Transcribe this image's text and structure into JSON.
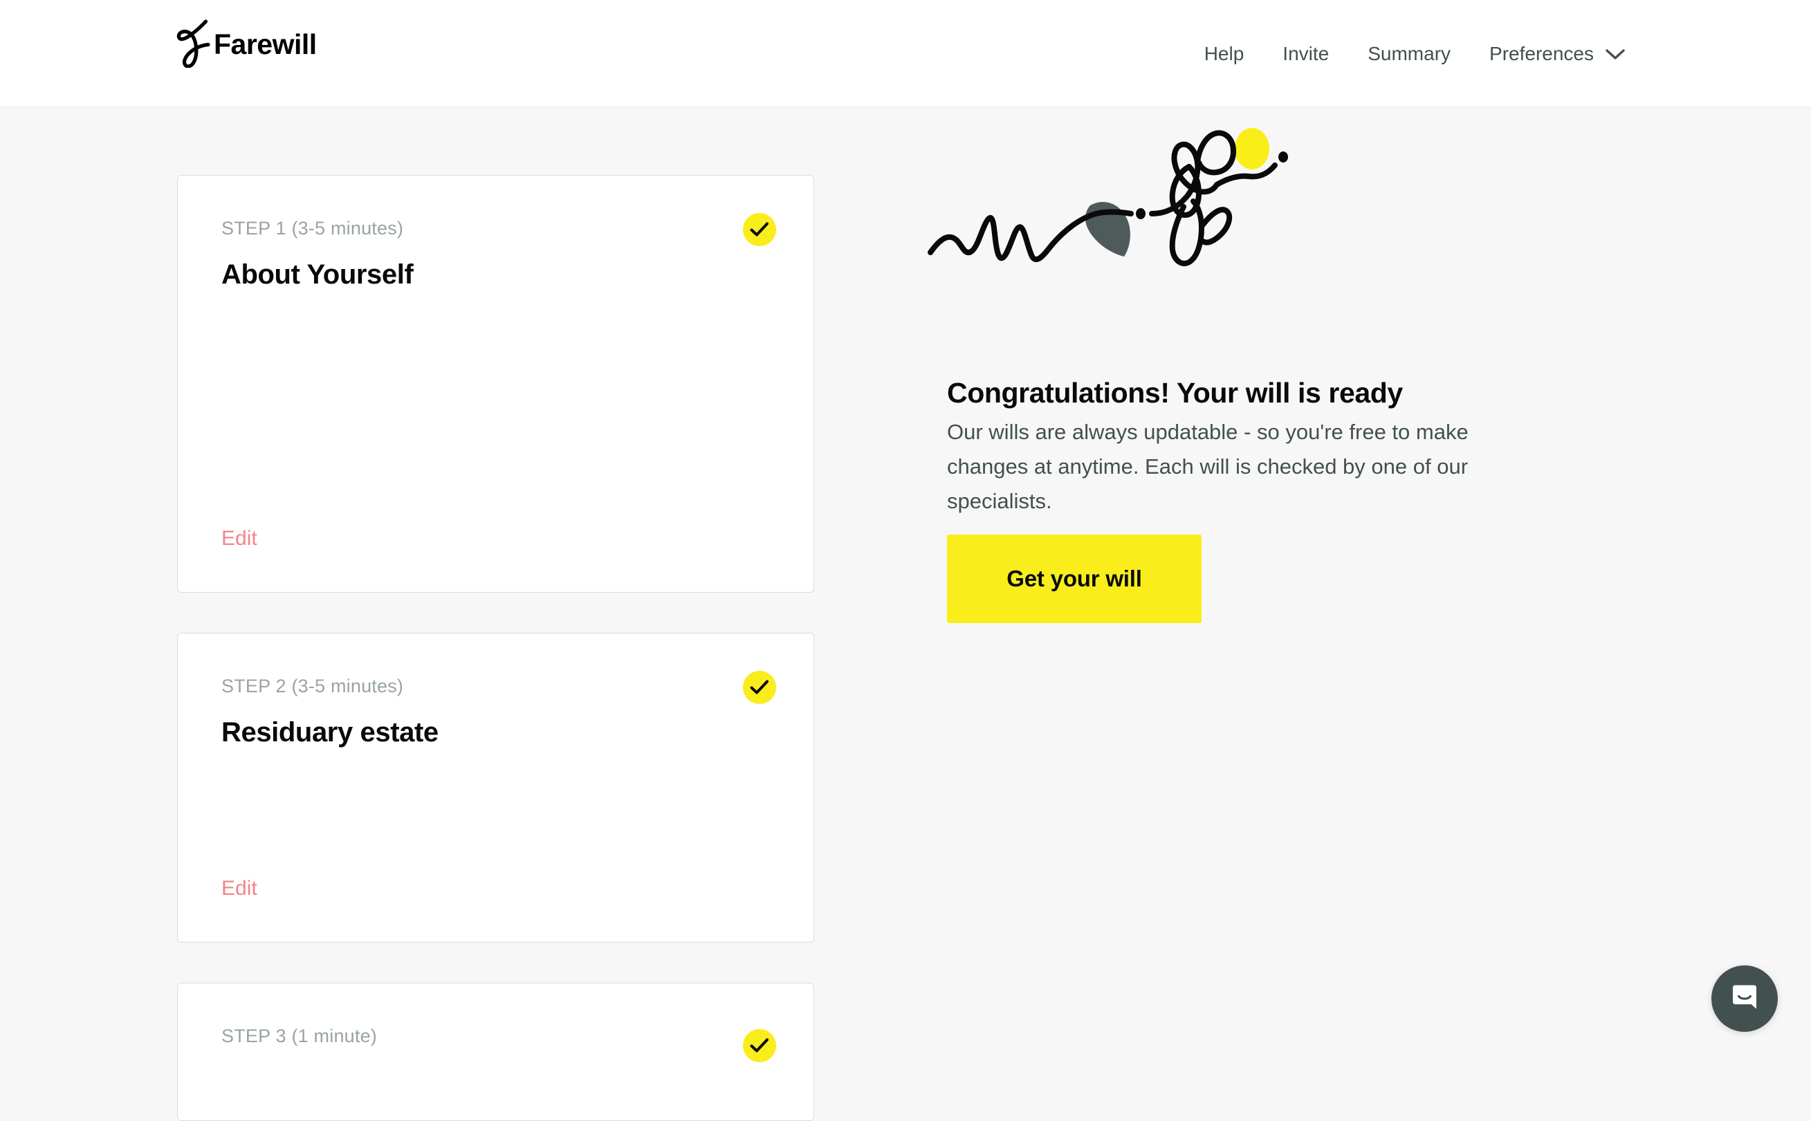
{
  "header": {
    "brand_name": "Farewill",
    "brand_mark_icon": "farewill-f-logo",
    "nav": [
      {
        "label": "Help",
        "name": "nav-help"
      },
      {
        "label": "Invite",
        "name": "nav-invite"
      },
      {
        "label": "Summary",
        "name": "nav-summary"
      },
      {
        "label": "Preferences",
        "name": "nav-preferences",
        "caret_icon": "chevron-down-icon"
      }
    ]
  },
  "steps": [
    {
      "eyebrow": "STEP 1 (3-5 minutes)",
      "title": "About Yourself",
      "edit_label": "Edit",
      "status_icon": "check-icon",
      "complete": true
    },
    {
      "eyebrow": "STEP 2 (3-5 minutes)",
      "title": "Residuary estate",
      "edit_label": "Edit",
      "status_icon": "check-icon",
      "complete": true
    },
    {
      "eyebrow": "STEP 3 (1 minute)",
      "title": "",
      "edit_label": "",
      "status_icon": "check-icon",
      "complete": true
    }
  ],
  "promo": {
    "illustration_icon": "squiggle-line-illustration",
    "heading": "Congratulations! Your will is ready",
    "body": "Our wills are always updatable - so you're free to make changes at anytime. Each will is checked by one of our specialists.",
    "cta_label": "Get your will"
  },
  "support": {
    "launcher_icon": "intercom-chat-bubble-icon"
  },
  "colors": {
    "page_background": "#F7F7F7",
    "header_background": "#FFFFFF",
    "card_background": "#FFFFFF",
    "card_border": "#DCDCDC",
    "accent_yellow": "#F9ED1C",
    "edit_link": "#F4838A",
    "body_text": "#42504F",
    "eyebrow_text": "#9AA3A3",
    "heading_text": "#0A0A0A",
    "illustration_gray": "#4F5B5B",
    "launcher_background": "#42504F"
  }
}
